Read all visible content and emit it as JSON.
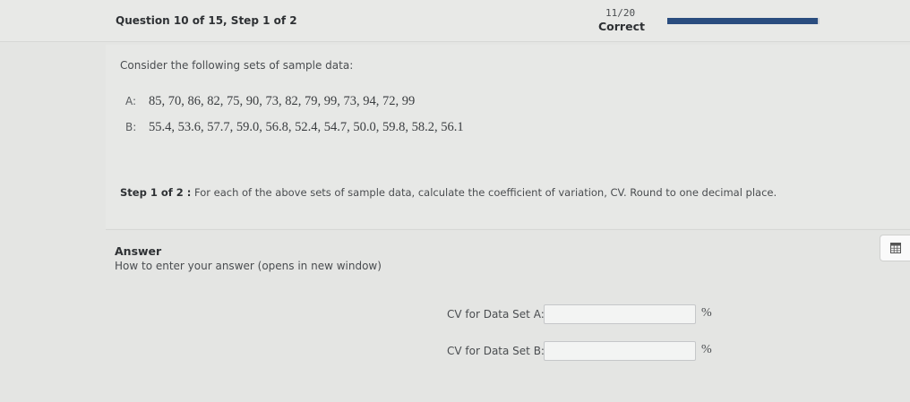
{
  "header": {
    "question_title": "Question 10 of 15, Step 1 of 2",
    "score": "11/20",
    "status": "Correct",
    "progress_fraction": 0.99
  },
  "question": {
    "intro": "Consider the following sets of sample data:",
    "sets": [
      {
        "label": "A:",
        "values": "85, 70, 86, 82, 75, 90, 73, 82, 79, 99, 73, 94, 72, 99"
      },
      {
        "label": "B:",
        "values": "55.4, 53.6, 57.7, 59.0, 56.8, 52.4, 54.7, 50.0, 59.8, 58.2, 56.1"
      }
    ],
    "step_label": "Step 1 of 2 :",
    "step_text": "For each of the above sets of sample data, calculate the coefficient of variation, CV. Round to one decimal place."
  },
  "answer": {
    "title": "Answer",
    "help_link": "How to enter your answer (opens in new window)",
    "fields": [
      {
        "label": "CV for Data Set A:",
        "value": "",
        "unit": "%"
      },
      {
        "label": "CV for Data Set B:",
        "value": "",
        "unit": "%"
      }
    ]
  },
  "colors": {
    "progress_fill": "#2a4d7f",
    "progress_track": "#cfd3d8"
  },
  "icons": {
    "calculator": "calculator-icon"
  }
}
